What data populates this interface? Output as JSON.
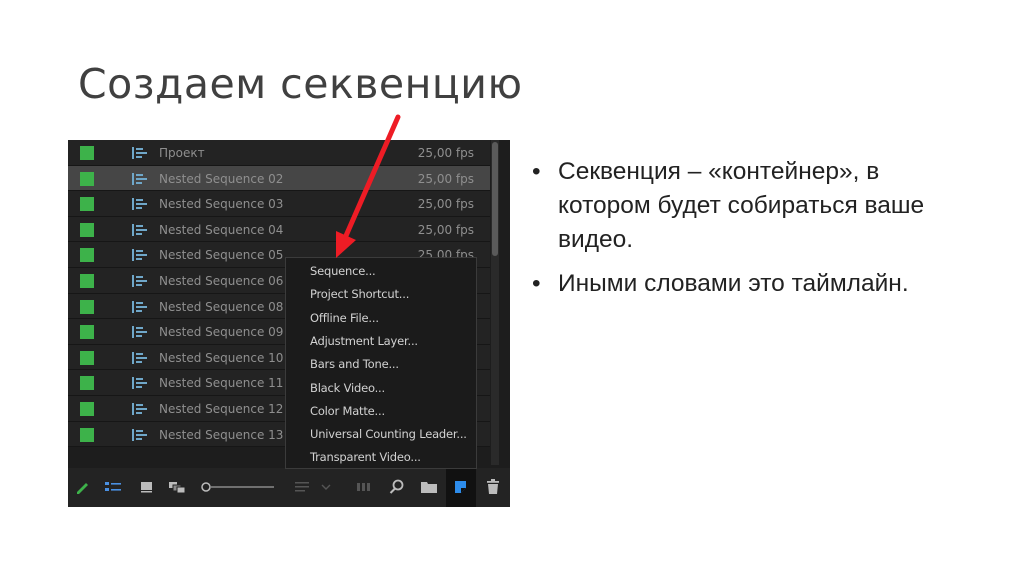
{
  "slide": {
    "title": "Создаем секвенцию",
    "bullets": [
      "Секвенция – «контейнер», в котором будет собираться ваше видео.",
      "Иными словами это таймлайн."
    ]
  },
  "project_panel": {
    "rows": [
      {
        "name": "Проект",
        "fps": "25,00 fps",
        "selected": false
      },
      {
        "name": "Nested Sequence 02",
        "fps": "25,00 fps",
        "selected": true
      },
      {
        "name": "Nested Sequence 03",
        "fps": "25,00 fps",
        "selected": false
      },
      {
        "name": "Nested Sequence 04",
        "fps": "25,00 fps",
        "selected": false
      },
      {
        "name": "Nested Sequence 05",
        "fps": "25,00 fps",
        "selected": false
      },
      {
        "name": "Nested Sequence 06",
        "fps": "",
        "selected": false
      },
      {
        "name": "Nested Sequence 08",
        "fps": "",
        "selected": false
      },
      {
        "name": "Nested Sequence 09",
        "fps": "",
        "selected": false
      },
      {
        "name": "Nested Sequence 10",
        "fps": "",
        "selected": false
      },
      {
        "name": "Nested Sequence 11",
        "fps": "",
        "selected": false
      },
      {
        "name": "Nested Sequence 12",
        "fps": "",
        "selected": false
      },
      {
        "name": "Nested Sequence 13",
        "fps": "",
        "selected": false
      }
    ],
    "item_color": "#3db24a",
    "toolbar_icons": [
      "pencil-icon",
      "list-view-icon",
      "icon-view-icon",
      "freeform-view-icon",
      "zoom-slider",
      "sort-icon",
      "automate-icon",
      "search-icon",
      "new-bin-icon",
      "new-item-icon",
      "trash-icon"
    ]
  },
  "new_item_menu": {
    "items": [
      "Sequence...",
      "Project Shortcut...",
      "Offline File...",
      "Adjustment Layer...",
      "Bars and Tone...",
      "Black Video...",
      "Color Matte...",
      "Universal Counting Leader...",
      "Transparent Video..."
    ]
  },
  "annotation": {
    "arrow_color": "#ee1c25"
  }
}
